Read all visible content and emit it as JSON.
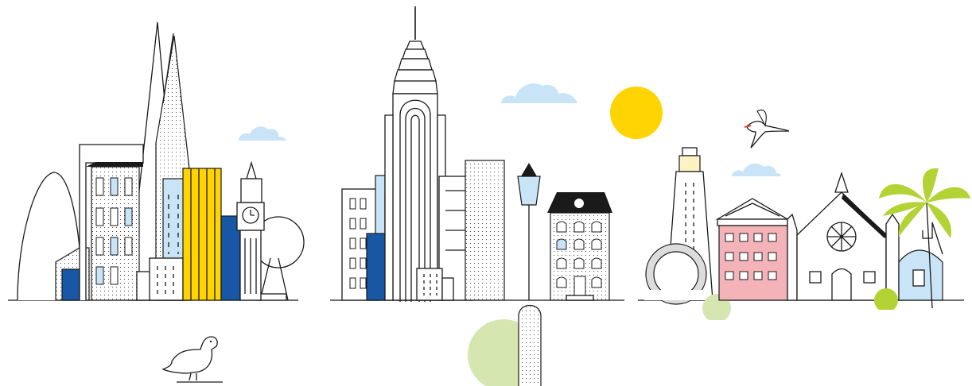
{
  "colors": {
    "outline": "#1a1a1a",
    "navy": "#1757a6",
    "yellow": "#ffd400",
    "light_blue": "#c9e4f7",
    "pink": "#f4b3b9",
    "green": "#b3d334",
    "pale_green": "#d6e6b0",
    "sun": "#ffd400",
    "background": "#ffffff"
  },
  "scenes": [
    {
      "name": "london",
      "landmarks": [
        "gherkin",
        "shard",
        "big-ben",
        "london-eye"
      ],
      "animal": "pigeon-icon"
    },
    {
      "name": "new-york",
      "landmarks": [
        "chrysler-building",
        "street-lamp",
        "townhouse"
      ],
      "animal": null
    },
    {
      "name": "caribbean",
      "landmarks": [
        "lighthouse",
        "colonial-house",
        "church",
        "palm-tree",
        "stone-arch"
      ],
      "animal": "tropicbird-icon"
    }
  ],
  "weather": {
    "sun": "sun-icon",
    "clouds": [
      "cloud-icon",
      "cloud-icon",
      "cloud-icon"
    ]
  }
}
